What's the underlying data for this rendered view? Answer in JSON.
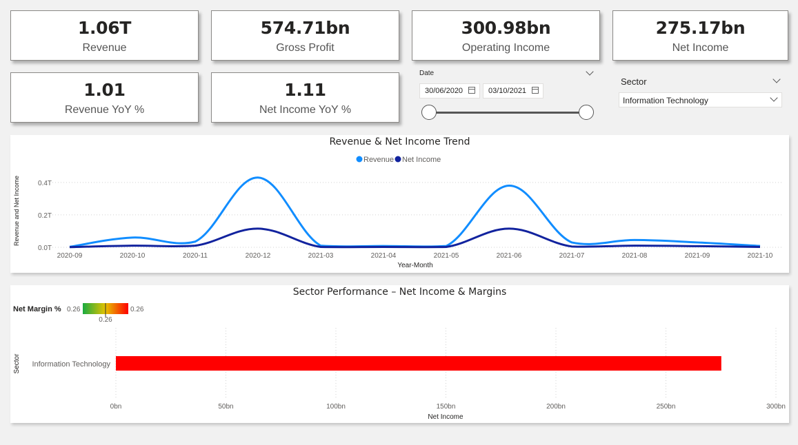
{
  "kpis": [
    {
      "value": "1.06T",
      "label": "Revenue"
    },
    {
      "value": "574.71bn",
      "label": "Gross Profit"
    },
    {
      "value": "300.98bn",
      "label": "Operating Income"
    },
    {
      "value": "275.17bn",
      "label": "Net Income"
    },
    {
      "value": "1.01",
      "label": "Revenue YoY %"
    },
    {
      "value": "1.11",
      "label": "Net Income YoY %"
    }
  ],
  "date_slicer": {
    "title": "Date",
    "start": "30/06/2020",
    "end": "03/10/2021"
  },
  "sector_slicer": {
    "title": "Sector",
    "selected": "Information Technology"
  },
  "colors": {
    "revenue": "#118dff",
    "net_income": "#12239e",
    "bar": "#ff0000",
    "gradient_low": "#1aab40",
    "gradient_high": "#ff0000"
  },
  "trend_chart": {
    "title": "Revenue & Net Income Trend",
    "legend": [
      "Revenue",
      "Net Income"
    ],
    "xlabel": "Year-Month",
    "ylabel": "Revenue and Net Income"
  },
  "sector_chart": {
    "title": "Sector Performance – Net Income & Margins",
    "legend_title": "Net Margin %",
    "legend_min": "0.26",
    "legend_max": "0.26",
    "legend_mid": "0.26",
    "xlabel": "Net Income",
    "ylabel": "Sector"
  },
  "chart_data": [
    {
      "type": "line",
      "title": "Revenue & Net Income Trend",
      "xlabel": "Year-Month",
      "ylabel": "Revenue and Net Income",
      "categories": [
        "2020-09",
        "2020-10",
        "2020-11",
        "2020-12",
        "2021-03",
        "2021-04",
        "2021-05",
        "2021-06",
        "2021-07",
        "2021-08",
        "2021-09",
        "2021-10"
      ],
      "series": [
        {
          "name": "Revenue",
          "values": [
            0.003,
            0.06,
            0.035,
            0.43,
            0.01,
            0.008,
            0.008,
            0.38,
            0.03,
            0.045,
            0.03,
            0.008
          ]
        },
        {
          "name": "Net Income",
          "values": [
            0.001,
            0.01,
            0.01,
            0.115,
            0.002,
            0.002,
            0.002,
            0.115,
            0.005,
            0.01,
            0.007,
            0.002
          ]
        }
      ],
      "yticks": [
        "0.0T",
        "0.2T",
        "0.4T"
      ],
      "ylim": [
        0,
        0.48
      ],
      "unit": "T",
      "grid": true,
      "legend_position": "top-center"
    },
    {
      "type": "bar",
      "orientation": "horizontal",
      "title": "Sector Performance – Net Income & Margins",
      "xlabel": "Net Income",
      "ylabel": "Sector",
      "categories": [
        "Information Technology"
      ],
      "values": [
        275.17
      ],
      "unit": "bn",
      "xticks": [
        "0bn",
        "50bn",
        "100bn",
        "150bn",
        "200bn",
        "250bn",
        "300bn"
      ],
      "xlim": [
        0,
        300
      ],
      "net_margin": [
        0.26
      ],
      "grid": true,
      "legend_position": "top-left"
    }
  ]
}
